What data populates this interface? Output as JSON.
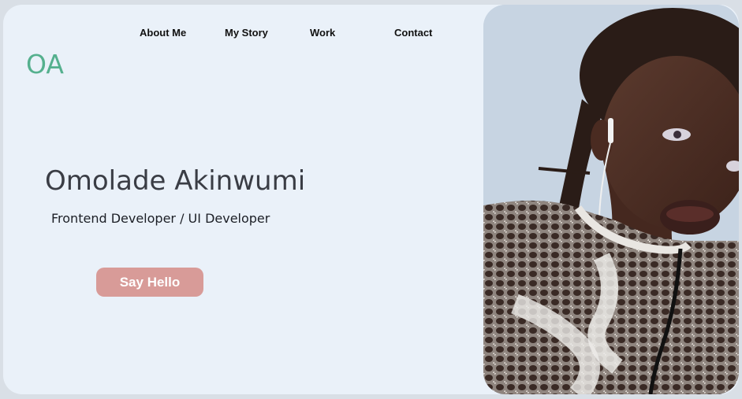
{
  "logo": {
    "text": "OA"
  },
  "nav": {
    "items": [
      {
        "label": "About Me"
      },
      {
        "label": "My Story"
      },
      {
        "label": "Work"
      },
      {
        "label": "Contact"
      }
    ]
  },
  "hero": {
    "name": "Omolade Akinwumi",
    "role": "Frontend Developer / UI Developer",
    "cta_label": "Say Hello"
  },
  "colors": {
    "background": "#eaf1f9",
    "logo": "#55b08e",
    "button": "#d89b98",
    "heading": "#3a3d45"
  }
}
